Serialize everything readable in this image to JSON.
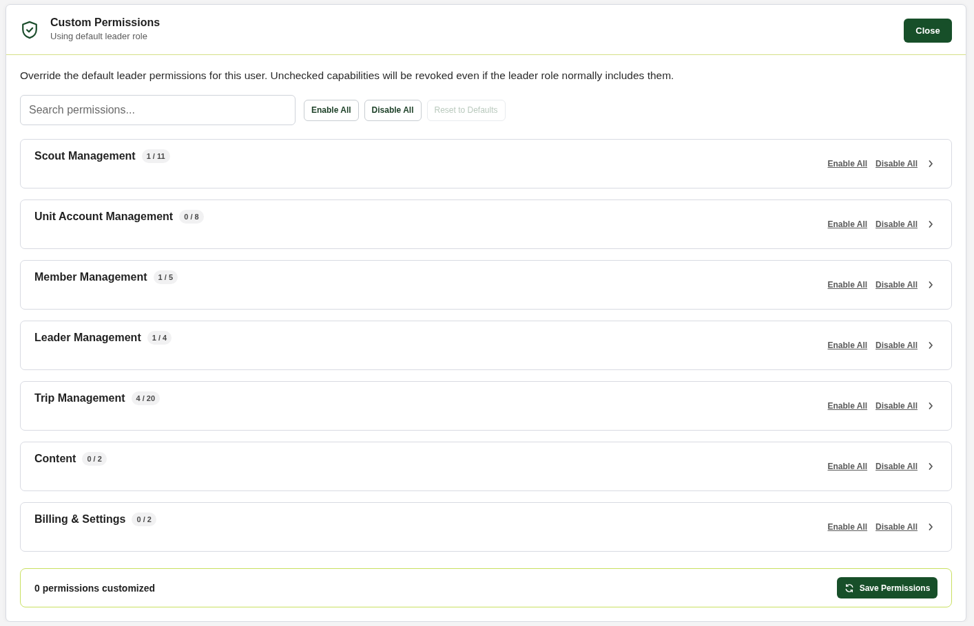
{
  "dialog": {
    "header": {
      "title": "Custom Permissions",
      "subtitle": "Using default leader role",
      "close_button": "Close"
    },
    "description": "Override the default leader permissions for this user. Unchecked capabilities will be revoked even if the leader role normally includes them.",
    "search": {
      "placeholder": "Search permissions..."
    },
    "actions": [
      {
        "label": "Enable All",
        "disabled": false
      },
      {
        "label": "Disable All",
        "disabled": false
      },
      {
        "label": "Reset to Defaults",
        "disabled": true
      }
    ],
    "groups": [
      {
        "name": "Scout Management",
        "count": "1 / 11",
        "enable_link": "Enable All",
        "disable_link": "Disable All",
        "expanded": false
      },
      {
        "name": "Unit Account Management",
        "count": "0 / 8",
        "enable_link": "Enable All",
        "disable_link": "Disable All",
        "expanded": false
      },
      {
        "name": "Member Management",
        "count": "1 / 5",
        "enable_link": "Enable All",
        "disable_link": "Disable All",
        "expanded": false
      },
      {
        "name": "Leader Management",
        "count": "1 / 4",
        "enable_link": "Enable All",
        "disable_link": "Disable All",
        "expanded": false
      },
      {
        "name": "Trip Management",
        "count": "4 / 20",
        "enable_link": "Enable All",
        "disable_link": "Disable All",
        "expanded": false
      },
      {
        "name": "Content",
        "count": "0 / 2",
        "enable_link": "Enable All",
        "disable_link": "Disable All",
        "expanded": false
      },
      {
        "name": "Billing & Settings",
        "count": "0 / 2",
        "enable_link": "Enable All",
        "disable_link": "Disable All",
        "expanded": false
      }
    ],
    "footer": {
      "status": "0 permissions customized",
      "save_button": "Save Permissions"
    }
  }
}
